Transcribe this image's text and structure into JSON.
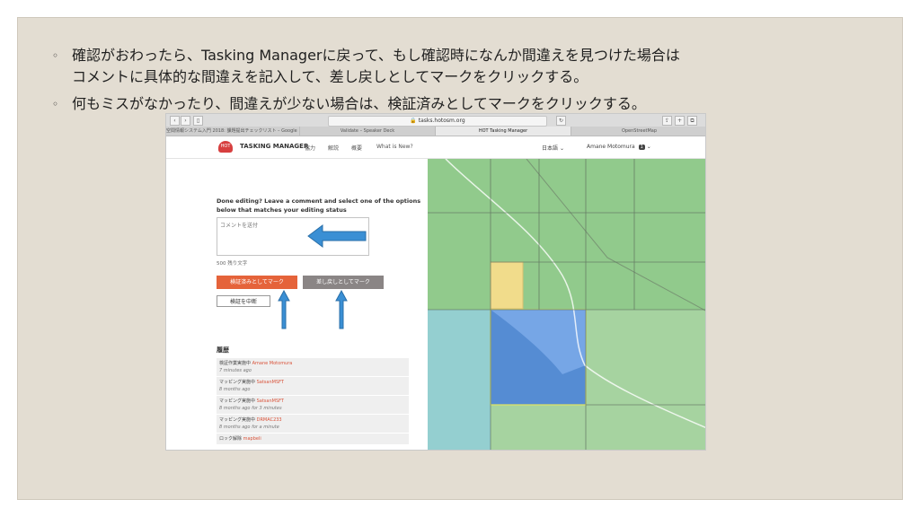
{
  "slide": {
    "bullets": [
      {
        "mark": "◦",
        "lines": [
          "確認がおわったら、Tasking Managerに戻って、もし確認時になんか間違えを見つけた場合は",
          "コメントに具体的な間違えを記入して、差し戻しとしてマークをクリックする。"
        ]
      },
      {
        "mark": "◦",
        "lines": [
          "何もミスがなかったり、間違えが少ない場合は、検証済みとしてマークをクリックする。"
        ]
      }
    ]
  },
  "browser": {
    "url": "tasks.hotosm.org",
    "tabs": [
      "空間情報システム入門 2018: 課題提出チェックリスト – Google スプー",
      "Validate – Speaker Deck",
      "HOT Tasking Manager",
      "OpenStreetMap"
    ],
    "active_tab": 2
  },
  "app": {
    "brand": "TASKING MANAGER",
    "logo_text": "HOT",
    "nav": [
      "協力",
      "解説",
      "概要",
      "What is New?"
    ],
    "language": "日本語",
    "user": "Amane Motomura",
    "user_badge": "1"
  },
  "panel": {
    "prompt": "Done editing? Leave a comment and select one of the options below that matches your editing status",
    "comment_placeholder": "コメントを送付",
    "char_count": "500 残り文字",
    "validate_label": "検証済みとしてマーク",
    "invalidate_label": "差し戻しとしてマーク",
    "stop_label": "検証を中断",
    "history_title": "履歴",
    "history": [
      {
        "action": "検証作業実施中",
        "who": "Amane Motomura",
        "when": "7 minutes ago"
      },
      {
        "action": "マッピング実施中",
        "who": "SatsanMSFT",
        "when": "8 months ago"
      },
      {
        "action": "マッピング実施中",
        "who": "SatsanMSFT",
        "when": "8 months ago for 3 minutes"
      },
      {
        "action": "マッピング実施中",
        "who": "DRMAC233",
        "when": "8 months ago for a minute"
      },
      {
        "action": "ロック解除",
        "who": "mapbeli",
        "when": ""
      }
    ]
  },
  "colors": {
    "validate": "#e5633a",
    "invalidate": "#8a8585",
    "arrow": "#3a8fd4",
    "tile_green": "#8fc98a",
    "tile_yellow": "#f1dc8b",
    "tile_selected": "#4f86d8"
  },
  "icons": [
    "back-icon",
    "forward-icon",
    "sidebar-icon",
    "lock-icon",
    "reload-icon",
    "share-icon",
    "add-tab-icon",
    "tabs-icon",
    "chevron-down-icon",
    "arrow-left-icon",
    "arrow-up-icon"
  ]
}
